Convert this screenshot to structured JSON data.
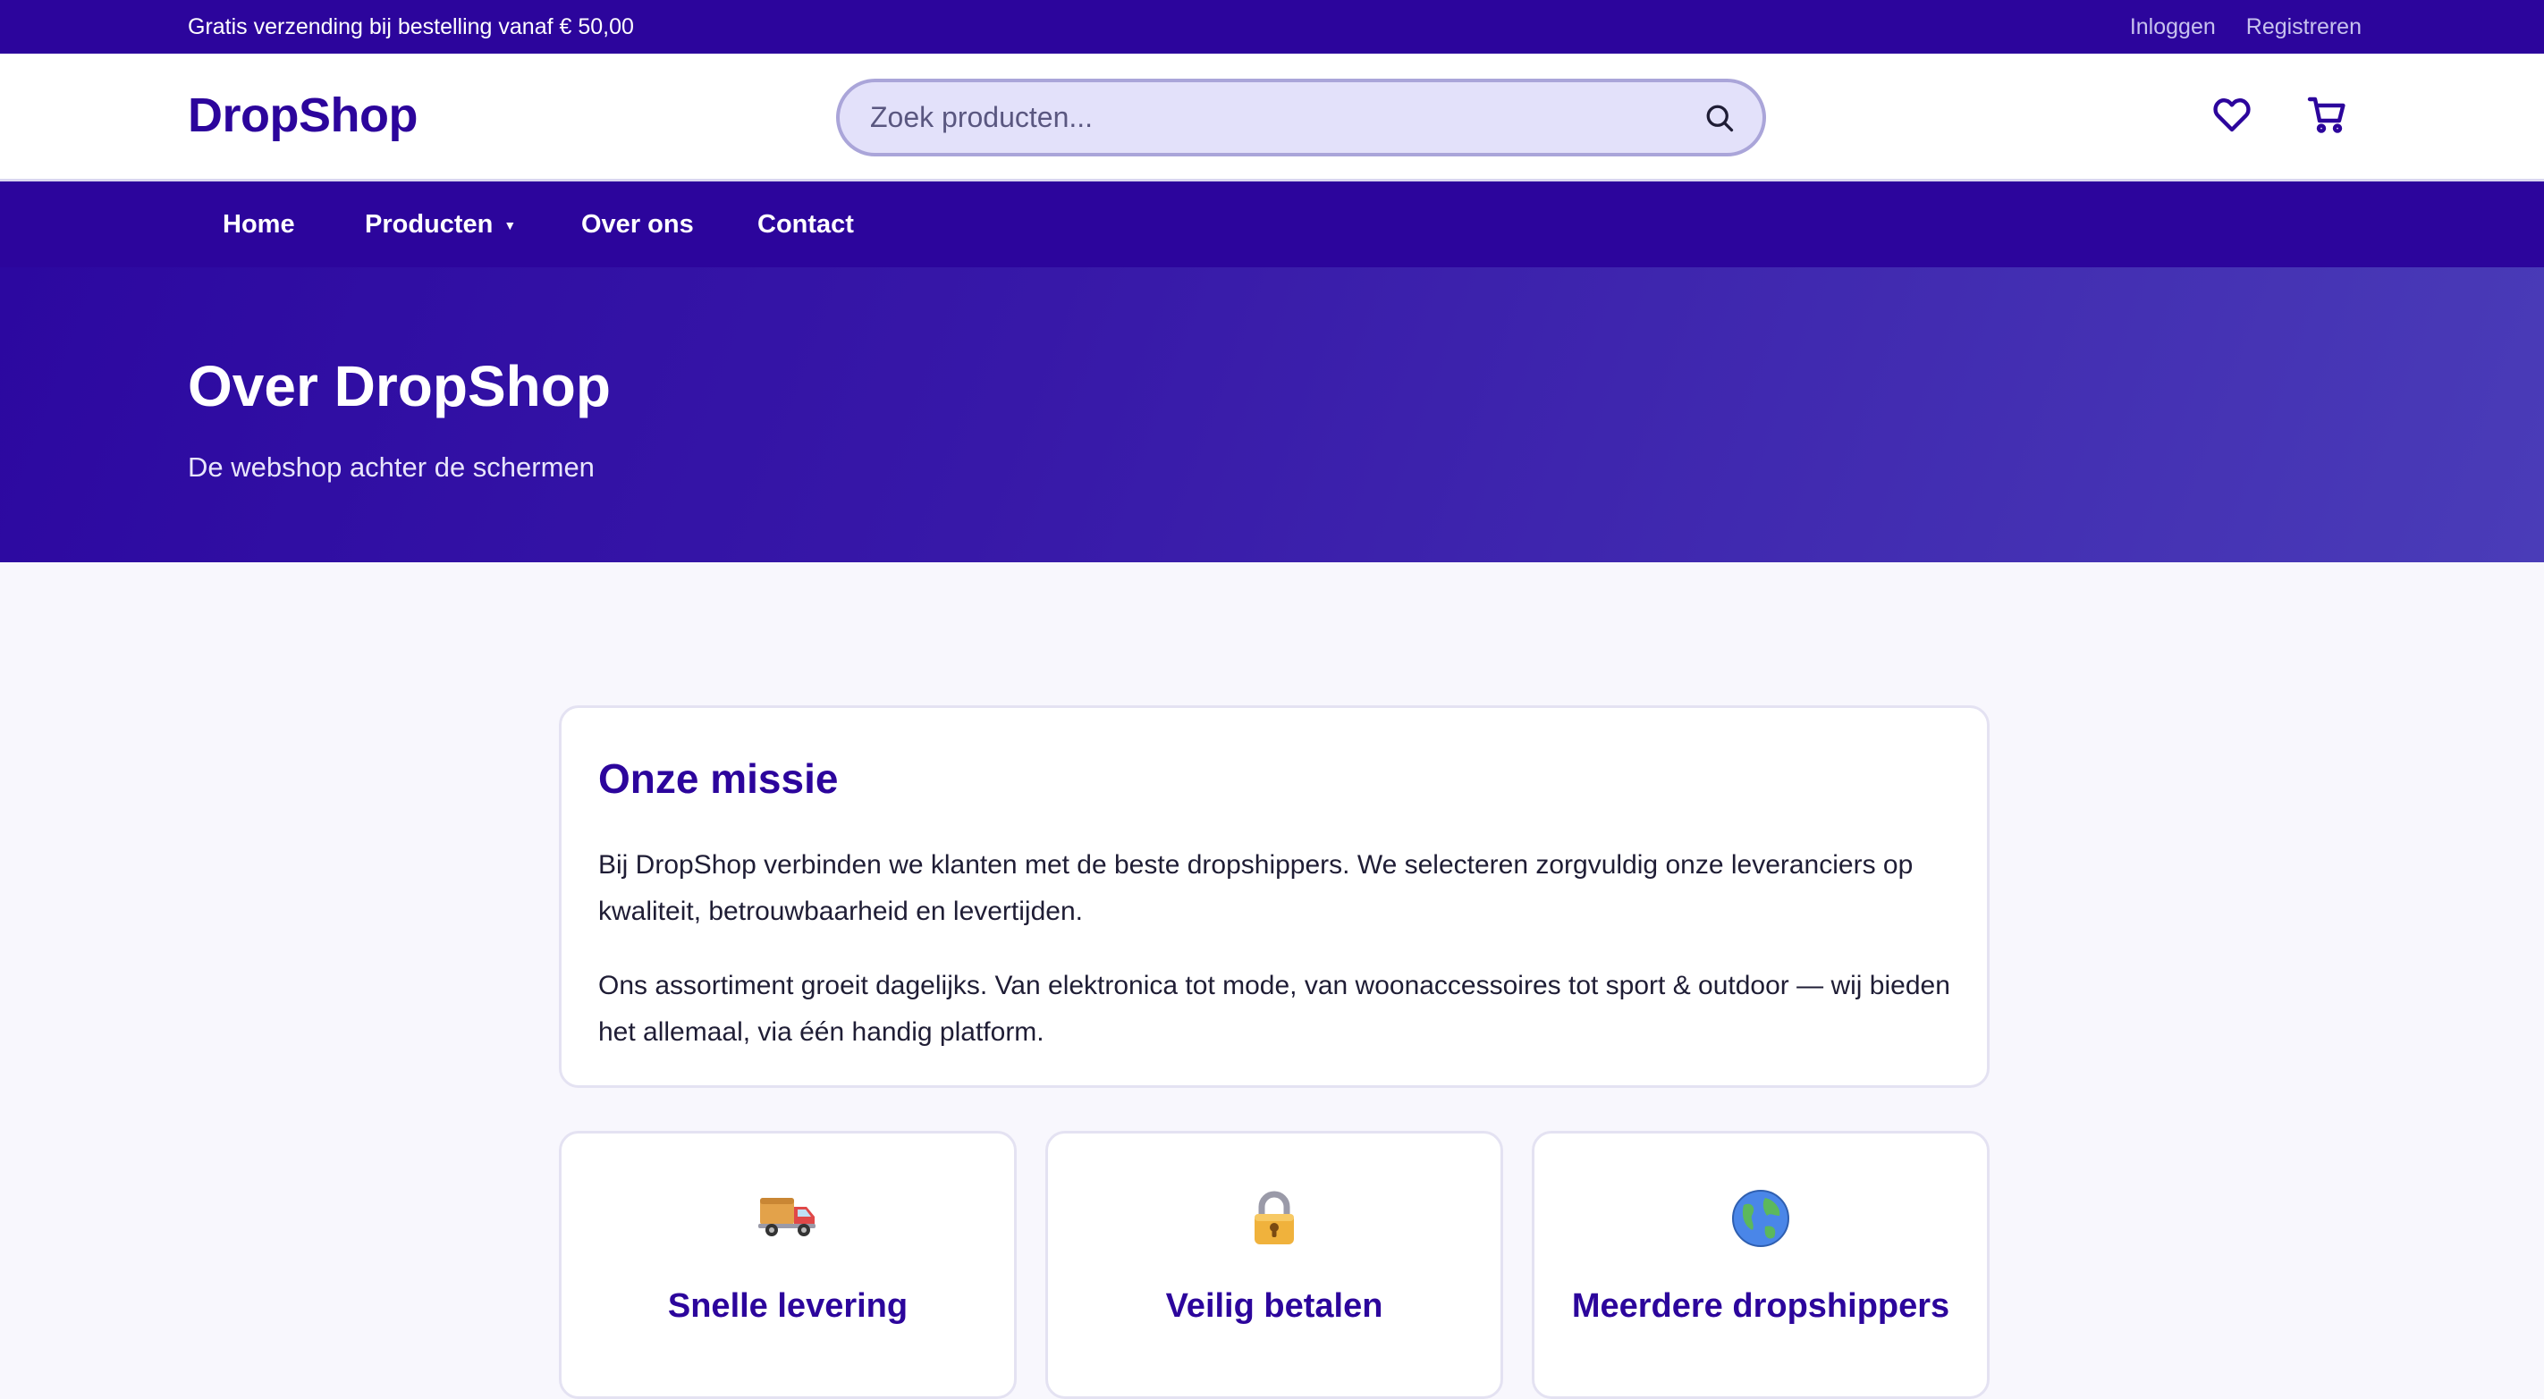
{
  "topbar": {
    "promo": "Gratis verzending bij bestelling vanaf € 50,00",
    "login": "Inloggen",
    "register": "Registreren"
  },
  "header": {
    "logo": "DropShop",
    "search_placeholder": "Zoek producten...",
    "icons": [
      "search-icon",
      "heart-icon",
      "cart-icon"
    ]
  },
  "nav": {
    "items": [
      {
        "label": "Home"
      },
      {
        "label": "Producten",
        "has_dropdown": true
      },
      {
        "label": "Over ons"
      },
      {
        "label": "Contact"
      }
    ]
  },
  "hero": {
    "title": "Over DropShop",
    "subtitle": "De webshop achter de schermen"
  },
  "mission": {
    "title": "Onze missie",
    "paragraphs": [
      "Bij DropShop verbinden we klanten met de beste dropshippers. We selecteren zorgvuldig onze leveranciers op kwaliteit, betrouwbaarheid en levertijden.",
      "Ons assortiment groeit dagelijks. Van elektronica tot mode, van woonaccessoires tot sport & outdoor — wij bieden het allemaal, via één handig platform."
    ]
  },
  "features": [
    {
      "icon": "truck-icon",
      "title": "Snelle levering"
    },
    {
      "icon": "lock-icon",
      "title": "Veilig betalen"
    },
    {
      "icon": "globe-icon",
      "title": "Meerdere dropshippers"
    }
  ],
  "colors": {
    "brand": "#2c059c",
    "search_bg": "#e3e1fa",
    "page_bg": "#f8f7fd"
  }
}
